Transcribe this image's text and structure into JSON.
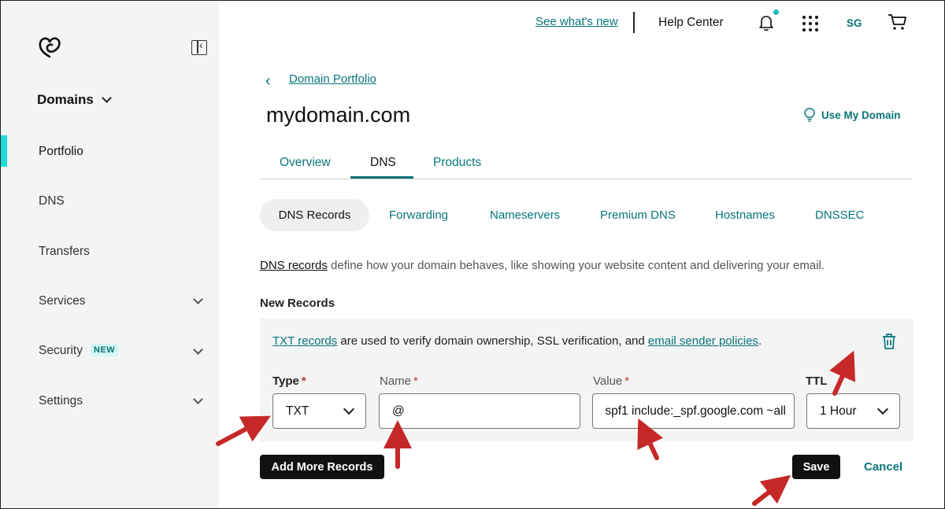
{
  "top_bar": {
    "whats_new": "See what's new",
    "help_center": "Help Center",
    "user_initials": "SG"
  },
  "sidebar": {
    "section_title": "Domains",
    "items": [
      {
        "label": "Portfolio"
      },
      {
        "label": "DNS"
      },
      {
        "label": "Transfers"
      },
      {
        "label": "Services"
      },
      {
        "label": "Security",
        "badge": "NEW"
      },
      {
        "label": "Settings"
      }
    ]
  },
  "header": {
    "breadcrumb": "Domain Portfolio",
    "title": "mydomain.com",
    "use_my_domain": "Use My Domain"
  },
  "tabs": [
    "Overview",
    "DNS",
    "Products"
  ],
  "subtabs": [
    "DNS Records",
    "Forwarding",
    "Nameservers",
    "Premium DNS",
    "Hostnames",
    "DNSSEC"
  ],
  "description": {
    "link": "DNS records",
    "text": " define how your domain behaves, like showing your website content and delivering your email."
  },
  "new_records": {
    "label": "New Records",
    "info_link1": "TXT records",
    "info_mid": " are used to verify domain ownership, SSL verification, and ",
    "info_link2": "email sender policies",
    "info_end": ".",
    "type_label": "Type",
    "type_value": "TXT",
    "name_label": "Name",
    "name_value": "@",
    "value_label": "Value",
    "value_value": "spf1 include:_spf.google.com ~all",
    "ttl_label": "TTL",
    "ttl_value": "1 Hour",
    "required_mark": "*"
  },
  "actions": {
    "add_more": "Add More Records",
    "save": "Save",
    "cancel": "Cancel"
  },
  "colors": {
    "accent": "#09757a",
    "active_bar": "#1bdbdb",
    "annotation": "#c62828"
  }
}
